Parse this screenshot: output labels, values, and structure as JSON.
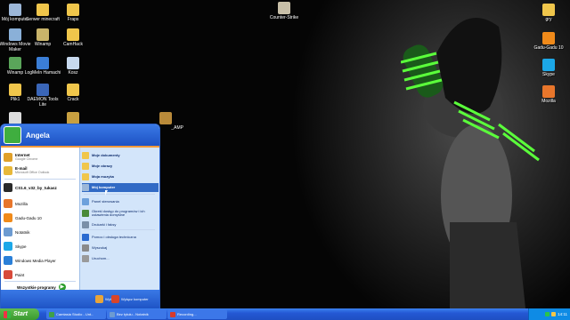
{
  "desktop": {
    "icons_left": [
      {
        "label": "Mój komputer",
        "icon": "computer-icon",
        "color": "#9cb7d8"
      },
      {
        "label": "Serwer minecraft",
        "icon": "folder-icon",
        "color": "#f0c64b"
      },
      {
        "label": "Fraps",
        "icon": "folder-icon",
        "color": "#f0c64b"
      },
      {
        "label": "Windows Movie Maker",
        "icon": "movie-maker-icon",
        "color": "#8ab0d8"
      },
      {
        "label": "Winamp",
        "icon": "winamp-icon",
        "color": "#c9b46a"
      },
      {
        "label": "CamHack",
        "icon": "folder-icon",
        "color": "#f0c64b"
      },
      {
        "label": "Winamp",
        "icon": "winamp-icon",
        "color": "#5aa55a"
      },
      {
        "label": "LogMeIn Hamachi",
        "icon": "hamachi-icon",
        "color": "#3b7ed6"
      },
      {
        "label": "Kosz",
        "icon": "recycle-bin-icon",
        "color": "#c7d9ee"
      },
      {
        "label": "Plik1",
        "icon": "folder-icon",
        "color": "#f0c64b"
      },
      {
        "label": "DAEMON Tools Lite",
        "icon": "daemon-tools-icon",
        "color": "#3a66b8"
      },
      {
        "label": "Crack",
        "icon": "folder-icon",
        "color": "#f0c64b"
      }
    ],
    "icons_right": [
      {
        "label": "gry",
        "icon": "folder-icon",
        "color": "#f0c64b"
      },
      {
        "label": "Gadu-Gadu 10",
        "icon": "gadu-gadu-icon",
        "color": "#f08a1a"
      },
      {
        "label": "Skype",
        "icon": "skype-icon",
        "color": "#1ca8e8"
      },
      {
        "label": "Mozilla",
        "icon": "firefox-icon",
        "color": "#e8762b"
      }
    ],
    "counter_strike_label": "Counter-Strike",
    "partial_icon_label": "_АМР"
  },
  "start_menu": {
    "username": "Angela",
    "pinned": [
      {
        "title": "Internet",
        "subtitle": "Google Chrome",
        "icon": "chrome-icon",
        "color": "#e0a02a"
      },
      {
        "title": "E-mail",
        "subtitle": "Microsoft Office Outlook",
        "icon": "outlook-icon",
        "color": "#e8b83a"
      }
    ],
    "recent": [
      {
        "label": "CS1.6_v32_by_tukasz",
        "icon": "cs-icon",
        "color": "#2a2a2a"
      },
      {
        "label": "Mozilla",
        "icon": "firefox-icon",
        "color": "#e8762b"
      },
      {
        "label": "Gadu-Gadu 10",
        "icon": "gadu-gadu-icon",
        "color": "#f08a1a"
      },
      {
        "label": "Notatnik",
        "icon": "notepad-icon",
        "color": "#6d9bd1"
      },
      {
        "label": "Skype",
        "icon": "skype-icon",
        "color": "#1ca8e8"
      },
      {
        "label": "Windows Media Player",
        "icon": "media-player-icon",
        "color": "#2a7fd8"
      },
      {
        "label": "Paint",
        "icon": "paint-icon",
        "color": "#d84a3a"
      }
    ],
    "all_programs": "Wszystkie programy",
    "right": [
      {
        "label": "Moje dokumenty",
        "icon": "documents-icon",
        "color": "#f0c64b",
        "bold": true
      },
      {
        "label": "Moje obrazy",
        "icon": "pictures-icon",
        "color": "#f0c64b",
        "bold": true
      },
      {
        "label": "Moja muzyka",
        "icon": "music-icon",
        "color": "#f0c64b",
        "bold": true
      },
      {
        "label": "Mój komputer",
        "icon": "computer-icon",
        "color": "#9cb7d8",
        "bold": true,
        "selected": true
      },
      {
        "label": "Panel sterowania",
        "icon": "control-panel-icon",
        "color": "#6da1dc",
        "bold": false
      },
      {
        "label": "Określ dostęp do programów i ich ustawienia domyślne",
        "icon": "default-programs-icon",
        "color": "#4a8a3a",
        "bold": false
      },
      {
        "label": "Drukarki i faksy",
        "icon": "printer-icon",
        "color": "#7a8fa8",
        "bold": false
      },
      {
        "label": "Pomoc i obsługa techniczna",
        "icon": "help-icon",
        "color": "#2a6ad0",
        "bold": false
      },
      {
        "label": "Wyszukaj",
        "icon": "search-icon",
        "color": "#8a8a8a",
        "bold": false
      },
      {
        "label": "Uruchom...",
        "icon": "run-icon",
        "color": "#9a9a9a",
        "bold": false
      }
    ],
    "logoff": "Wyloguj",
    "shutdown": "Wyłącz komputer"
  },
  "taskbar": {
    "start_label": "Start",
    "buttons": [
      {
        "label": "Camtasia Studio - Unt...",
        "icon": "camtasia-icon",
        "color": "#3fa04a"
      },
      {
        "label": "Bez tytułu - Notatnik",
        "icon": "notepad-icon",
        "color": "#6d9bd1"
      },
      {
        "label": "Recording...",
        "icon": "record-icon",
        "color": "#d83a2a"
      }
    ],
    "clock": "14:11"
  }
}
